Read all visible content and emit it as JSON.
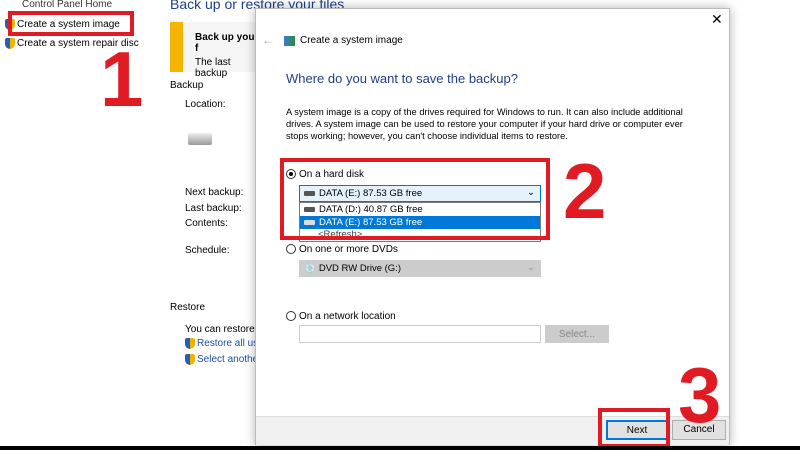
{
  "left_panel": {
    "control_panel_home": "Control Panel Home",
    "create_system_image": "Create a system image",
    "create_repair_disc": "Create a system repair disc"
  },
  "main": {
    "title": "Back up or restore your files",
    "banner_title": "Back up your f",
    "banner_text": "The last backup",
    "backup_section": "Backup",
    "location": "Location:",
    "next_backup": "Next backup:",
    "last_backup": "Last backup:",
    "contents": "Contents:",
    "schedule": "Schedule:",
    "restore_section": "Restore",
    "restore_text": "You can restore yo",
    "restore_all": "Restore all user",
    "select_another": "Select another"
  },
  "dialog": {
    "title": "Create a system image",
    "heading": "Where do you want to save the backup?",
    "description": "A system image is a copy of the drives required for Windows to run. It can also include additional drives. A system image can be used to restore your computer if your hard drive or computer ever stops working; however, you can't choose individual items to restore.",
    "hard_disk_label": "On a hard disk",
    "hard_disk_selected": "DATA (E:)  87.53 GB free",
    "hard_disk_options": [
      "DATA (D:)  40.87 GB free",
      "DATA (E:)  87.53 GB free",
      "<Refresh>"
    ],
    "dvd_label": "On one or more DVDs",
    "dvd_selected": "DVD RW Drive (G:)",
    "network_label": "On a network location",
    "network_value": "",
    "select_button": "Select...",
    "next_button": "Next",
    "cancel_button": "Cancel"
  },
  "annotations": {
    "step1": "1",
    "step2": "2",
    "step3": "3"
  },
  "colors": {
    "accent": "#0078d7",
    "annotation": "#e01b24",
    "heading": "#1e3f87"
  }
}
